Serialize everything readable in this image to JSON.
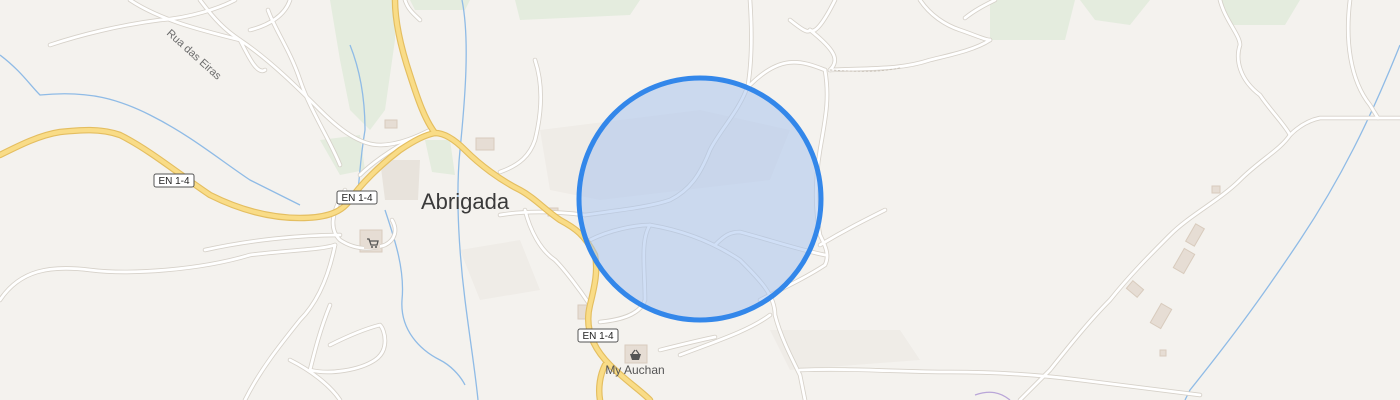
{
  "map": {
    "place_label": "Abrigada",
    "street_label": "Rua das Eiras",
    "road_shields": [
      "EN 1-4",
      "EN 1-4",
      "EN 1-4"
    ],
    "poi": [
      {
        "label": "My Auchan",
        "icon": "shopping-basket-icon"
      },
      {
        "label": "",
        "icon": "shopping-cart-icon"
      }
    ],
    "selection": {
      "shape": "circle",
      "fill_color": "#c7d9f3",
      "stroke_color": "#3387ea"
    },
    "colors": {
      "background": "#f4f2ee",
      "green_area": "#e2ebdb",
      "main_road_fill": "#f9dc87",
      "main_road_casing": "#e5bf61",
      "minor_road": "#ffffff",
      "water": "#8fbbe6"
    }
  }
}
